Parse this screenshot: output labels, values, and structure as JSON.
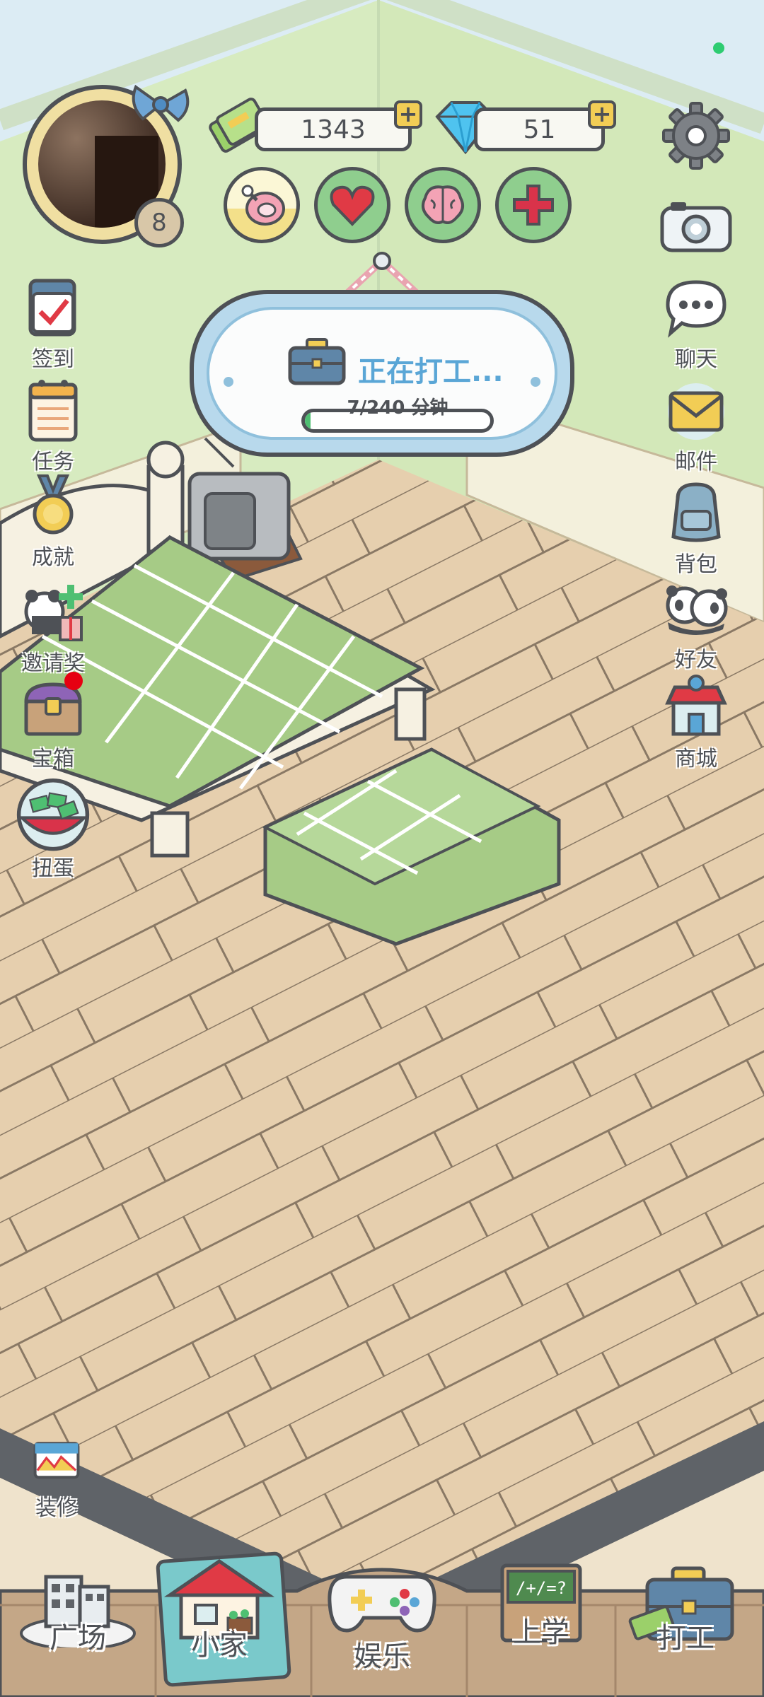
{
  "hud": {
    "level": "8",
    "coins": "1343",
    "diamonds": "51",
    "stats": [
      {
        "name": "food",
        "icon": "ham-icon"
      },
      {
        "name": "health",
        "icon": "heart-icon"
      },
      {
        "name": "mind",
        "icon": "brain-icon"
      },
      {
        "name": "medical",
        "icon": "cross-icon"
      }
    ]
  },
  "work": {
    "title": "正在打工...",
    "progress_text": "7/240 分钟",
    "progress_fraction": 0.029
  },
  "left_menu": {
    "checkin": "签到",
    "tasks": "任务",
    "achievements": "成就",
    "invite": "邀请奖",
    "treasure": "宝箱",
    "gacha": "扭蛋",
    "decorate": "装修"
  },
  "right_menu": {
    "chat": "聊天",
    "mail": "邮件",
    "bag": "背包",
    "friends": "好友",
    "shop": "商城"
  },
  "nav": {
    "plaza": "广场",
    "home": "小家",
    "fun": "娱乐",
    "school": "上学",
    "work": "打工"
  },
  "colors": {
    "outline": "#4e5156",
    "wall": "#d7ebc0",
    "floor": "#e6cfae",
    "bedding": "#a6cb86",
    "accent_blue": "#5aa6d6",
    "status_dot": "#2ecc71"
  }
}
